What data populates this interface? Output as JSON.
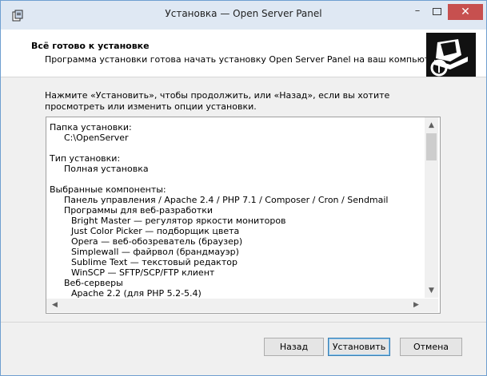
{
  "window": {
    "title": "Установка — Open Server Panel",
    "close_glyph": "✕",
    "minimize_glyph": "–"
  },
  "header": {
    "title": "Всё готово к установке",
    "subtitle": "Программа установки готова начать установку Open Server Panel на ваш компьютер."
  },
  "intro": "Нажмите «Установить», чтобы продолжить, или «Назад», если вы хотите просмотреть или изменить опции установки.",
  "memo": {
    "install_folder_label": "Папка установки:",
    "install_folder_value": "C:\\OpenServer",
    "setup_type_label": "Тип установки:",
    "setup_type_value": "Полная установка",
    "components_label": "Выбранные компоненты:",
    "components": [
      "Панель управления / Apache 2.4 / PHP 7.1 / Composer / Cron / Sendmail",
      "Программы для веб-разработки",
      "Bright Master — регулятор яркости мониторов",
      "Just Color Picker — подборщик цвета",
      "Opera — веб-обозреватель (браузер)",
      "Simplewall — файрвол (брандмауэр)",
      "Sublime Text — текстовый редактор",
      "WinSCP — SFTP/SCP/FTP клиент",
      "Веб-серверы",
      "Apache 2.2 (для PHP 5.2-5.4)"
    ]
  },
  "buttons": {
    "back": "Назад",
    "install": "Установить",
    "cancel": "Отмена"
  }
}
